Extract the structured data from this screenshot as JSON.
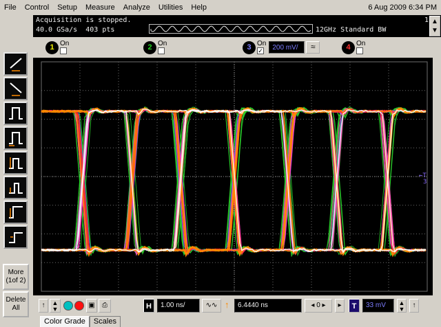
{
  "menu": {
    "items": [
      {
        "label": "File"
      },
      {
        "label": "Control"
      },
      {
        "label": "Setup"
      },
      {
        "label": "Measure"
      },
      {
        "label": "Analyze"
      },
      {
        "label": "Utilities"
      },
      {
        "label": "Help"
      }
    ],
    "datetime": "6 Aug 2009  6:34 PM"
  },
  "status": {
    "acquisition": "Acquisition is stopped.",
    "sample_rate": "40.0 GSa/s",
    "points": "403 pts",
    "bandwidth": "12GHz Standard BW",
    "corner": "1"
  },
  "channels": [
    {
      "num": "1",
      "on_label": "On",
      "checked": false,
      "color": "#f0f000"
    },
    {
      "num": "2",
      "on_label": "On",
      "checked": false,
      "color": "#22d022"
    },
    {
      "num": "3",
      "on_label": "On",
      "checked": true,
      "color": "#7d7dff",
      "scale": "200 mV/",
      "coupling": "≈"
    },
    {
      "num": "4",
      "on_label": "On",
      "checked": false,
      "color": "#ff3030"
    }
  ],
  "left_toolbar": {
    "more_label": "More",
    "more_page": "(1of 2)",
    "delete_label": "Delete",
    "delete_all": "All"
  },
  "timebase": {
    "h_label": "H",
    "scale": "1.00 ns/",
    "delay": "6.4440 ns",
    "trigger_label": "T",
    "trigger_level": "33 mV"
  },
  "tabs": [
    {
      "label": "Color Grade",
      "active": true
    },
    {
      "label": "Scales",
      "active": false
    }
  ],
  "trigger_marker": "←T",
  "trigger_marker_sub": "3",
  "colors": {
    "grid": "#6e6e6e",
    "trace_white": "#ffffff",
    "trace_orange": "#ff8a00",
    "trace_red": "#ff2a2a",
    "trace_magenta": "#ff40c0",
    "trace_blue": "#4a5cff",
    "trace_green": "#2ed12e"
  }
}
